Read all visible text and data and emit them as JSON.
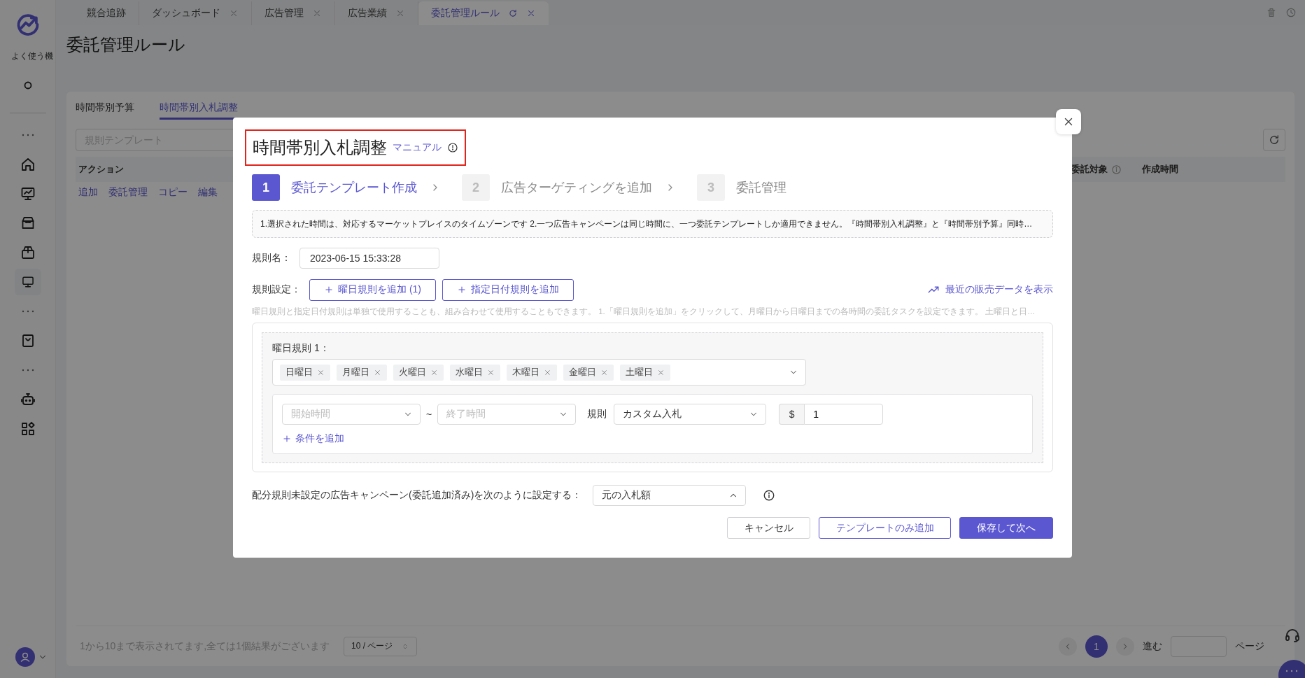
{
  "tabs": [
    {
      "label": "競合追跡",
      "selected": false,
      "closable": false
    },
    {
      "label": "ダッシュボード",
      "selected": false,
      "closable": true
    },
    {
      "label": "広告管理",
      "selected": false,
      "closable": true
    },
    {
      "label": "広告業績",
      "selected": false,
      "closable": true
    },
    {
      "label": "委託管理ルール",
      "selected": true,
      "closable": true
    }
  ],
  "sidebar": {
    "frequent_label": "よく使う機",
    "items": [
      {
        "kind": "icon",
        "selected": false
      },
      {
        "kind": "divider"
      },
      {
        "kind": "more"
      },
      {
        "kind": "icon",
        "selected": false
      },
      {
        "kind": "icon",
        "selected": false
      },
      {
        "kind": "icon",
        "selected": false
      },
      {
        "kind": "icon",
        "selected": false
      },
      {
        "kind": "icon",
        "selected": true
      },
      {
        "kind": "more"
      },
      {
        "kind": "icon",
        "selected": false
      },
      {
        "kind": "more"
      },
      {
        "kind": "icon",
        "selected": false
      },
      {
        "kind": "icon",
        "selected": false
      }
    ]
  },
  "page": {
    "title": "委託管理ルール",
    "subtabs": [
      {
        "label": "時間帯別予算",
        "selected": false
      },
      {
        "label": "時間帯別入札調整",
        "selected": true
      }
    ],
    "search": {
      "placeholder": "規則テンプレート"
    },
    "table": {
      "columns": [
        {
          "label": "アクション",
          "info": false
        },
        {
          "label": "委託対象",
          "info": true
        },
        {
          "label": "作成時間",
          "info": false
        }
      ],
      "row_actions": [
        "追加",
        "委託管理",
        "コピー",
        "編集"
      ]
    },
    "footer": {
      "summary": "1から10まで表示されてます,全ては1個結果がございます",
      "page_size": "10 / ページ",
      "pages": [
        {
          "label": "1",
          "selected": true
        }
      ],
      "goto_label": "進む",
      "page_suffix": "ページ"
    }
  },
  "modal": {
    "title": "時間帯別入札調整",
    "manual_link": "マニュアル",
    "highlighted": true,
    "steps": [
      {
        "number": "1",
        "label": "委託テンプレート作成",
        "active": true
      },
      {
        "number": "2",
        "label": "広告ターゲティングを追加",
        "active": false
      },
      {
        "number": "3",
        "label": "委託管理",
        "active": false
      }
    ],
    "notice": "1.選択された時間は、対応するマーケットプレイスのタイムゾーンです 2.一つ広告キャンペーンは同じ時間に、一つ委託テンプレートしか適用できません。『時間帯別入札調整』と『時間帯別予算』同時…",
    "rule_name": {
      "label": "規則名：",
      "value": "2023-06-15 15:33:28"
    },
    "rule_settings": {
      "label": "規則設定：",
      "buttons": [
        "曜日規則を追加 (1)",
        "指定日付規則を追加"
      ],
      "sales_link": "最近の販売データを表示",
      "hint": "曜日規則と指定日付規則は単独で使用することも、組み合わせて使用することもできます。 1.「曜日規則を追加」をクリックして、月曜日から日曜日までの各時間の委託タスクを設定できます。 土曜日と日…"
    },
    "weekday_rules": [
      {
        "title": "曜日規則 1：",
        "days": [
          "日曜日",
          "月曜日",
          "火曜日",
          "水曜日",
          "木曜日",
          "金曜日",
          "土曜日"
        ],
        "conditions": [
          {
            "start": {
              "placeholder": "開始時間"
            },
            "separator": "~",
            "end": {
              "placeholder": "終了時間"
            },
            "rule_label": "規則",
            "rule": "カスタム入札",
            "currency": "$",
            "amount": "1"
          }
        ],
        "add_condition": "条件を追加"
      }
    ],
    "fallback": {
      "label": "配分規則未設定の広告キャンペーン(委託追加済み)を次のように設定する：",
      "value": "元の入札額",
      "expanded": true
    },
    "buttons": [
      {
        "label": "キャンセル",
        "kind": "default"
      },
      {
        "label": "テンプレートのみ追加",
        "kind": "outline"
      },
      {
        "label": "保存して次へ",
        "kind": "primary"
      }
    ]
  }
}
